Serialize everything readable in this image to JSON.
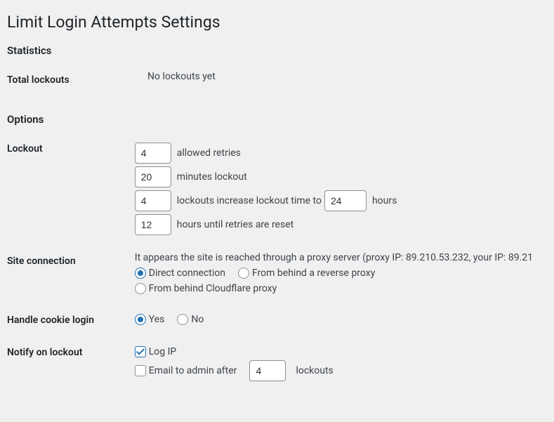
{
  "page": {
    "title": "Limit Login Attempts Settings"
  },
  "sections": {
    "statistics": {
      "heading": "Statistics",
      "total_lockouts_label": "Total lockouts",
      "total_lockouts_value": "No lockouts yet"
    },
    "options": {
      "heading": "Options",
      "lockout": {
        "label": "Lockout",
        "allowed_retries_value": "4",
        "allowed_retries_text": "allowed retries",
        "minutes_lockout_value": "20",
        "minutes_lockout_text": "minutes lockout",
        "increase_count_value": "4",
        "increase_text_prefix": "lockouts increase lockout time to",
        "increase_hours_value": "24",
        "increase_text_suffix": "hours",
        "reset_hours_value": "12",
        "reset_text": "hours until retries are reset"
      },
      "site_connection": {
        "label": "Site connection",
        "description": "It appears the site is reached through a proxy server (proxy IP: 89.210.53.232, your IP: 89.21",
        "option_direct": "Direct connection",
        "option_reverse_proxy": "From behind a reverse proxy",
        "option_cloudflare": "From behind Cloudflare proxy",
        "selected": "direct"
      },
      "handle_cookie_login": {
        "label": "Handle cookie login",
        "option_yes": "Yes",
        "option_no": "No",
        "selected": "yes"
      },
      "notify_on_lockout": {
        "label": "Notify on lockout",
        "option_log_ip": "Log IP",
        "log_ip_checked": true,
        "option_email_prefix": "Email to admin after",
        "email_after_value": "4",
        "option_email_suffix": "lockouts",
        "email_checked": false
      }
    }
  }
}
